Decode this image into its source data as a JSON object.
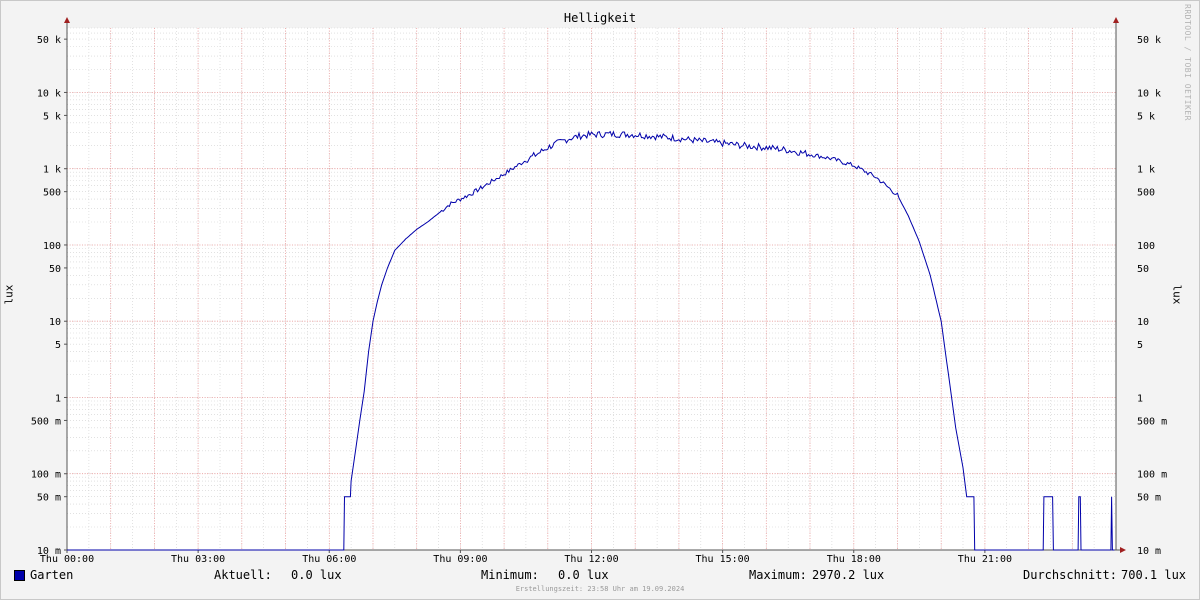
{
  "watermark": "RRDTOOL / TOBI OETIKER",
  "legend": {
    "series_name": "Garten",
    "current_label": "Aktuell:",
    "current_value": "0.0 lux",
    "min_label": "Minimum:",
    "min_value": "0.0 lux",
    "max_label": "Maximum:",
    "max_value": "2970.2 lux",
    "avg_label": "Durchschnitt:",
    "avg_value": "700.1 lux"
  },
  "footer": "Erstellungszeit: 23:58 Uhr am 19.09.2024",
  "colors": {
    "line": "#0000aa",
    "major_grid": "#f0a0a0",
    "minor_grid": "#d0d0d0",
    "background": "#ffffff",
    "page": "#f3f3f3"
  },
  "chart_data": {
    "type": "line",
    "title": "Helligkeit",
    "xlabel": "",
    "ylabel": "lux",
    "y_scale": "log",
    "ylim": [
      0.01,
      70000
    ],
    "xlim": [
      "Thu 00:00",
      "Thu 23:58"
    ],
    "x_ticks": [
      "Thu 00:00",
      "Thu 03:00",
      "Thu 06:00",
      "Thu 09:00",
      "Thu 12:00",
      "Thu 15:00",
      "Thu 18:00",
      "Thu 21:00"
    ],
    "y_ticks": [
      {
        "value": 0.01,
        "label": "10 m"
      },
      {
        "value": 0.05,
        "label": "50 m"
      },
      {
        "value": 0.1,
        "label": "100 m"
      },
      {
        "value": 0.5,
        "label": "500 m"
      },
      {
        "value": 1,
        "label": "1"
      },
      {
        "value": 5,
        "label": "5"
      },
      {
        "value": 10,
        "label": "10"
      },
      {
        "value": 50,
        "label": "50"
      },
      {
        "value": 100,
        "label": "100"
      },
      {
        "value": 500,
        "label": "500"
      },
      {
        "value": 1000,
        "label": "1 k"
      },
      {
        "value": 5000,
        "label": "5 k"
      },
      {
        "value": 10000,
        "label": "10 k"
      },
      {
        "value": 50000,
        "label": "50 k"
      }
    ],
    "grid": true,
    "legend_position": "bottom",
    "series": [
      {
        "name": "Garten",
        "color": "#0000aa",
        "points": [
          [
            "00:00",
            0.01
          ],
          [
            "06:20",
            0.01
          ],
          [
            "06:21",
            0.05
          ],
          [
            "06:29",
            0.05
          ],
          [
            "06:30",
            0.08
          ],
          [
            "06:36",
            0.2
          ],
          [
            "06:42",
            0.5
          ],
          [
            "06:48",
            1.2
          ],
          [
            "06:54",
            4
          ],
          [
            "07:00",
            10
          ],
          [
            "07:06",
            18
          ],
          [
            "07:12",
            30
          ],
          [
            "07:20",
            50
          ],
          [
            "07:30",
            85
          ],
          [
            "07:45",
            120
          ],
          [
            "08:00",
            160
          ],
          [
            "08:15",
            200
          ],
          [
            "08:30",
            260
          ],
          [
            "08:45",
            340
          ],
          [
            "09:00",
            400
          ],
          [
            "09:15",
            470
          ],
          [
            "09:30",
            570
          ],
          [
            "09:45",
            700
          ],
          [
            "10:00",
            850
          ],
          [
            "10:15",
            1050
          ],
          [
            "10:30",
            1300
          ],
          [
            "10:45",
            1550
          ],
          [
            "11:00",
            1900
          ],
          [
            "11:15",
            2200
          ],
          [
            "11:30",
            2500
          ],
          [
            "11:45",
            2700
          ],
          [
            "12:00",
            2800
          ],
          [
            "12:30",
            2850
          ],
          [
            "13:00",
            2800
          ],
          [
            "13:30",
            2650
          ],
          [
            "14:00",
            2500
          ],
          [
            "14:30",
            2300
          ],
          [
            "15:00",
            2150
          ],
          [
            "15:30",
            2000
          ],
          [
            "16:00",
            1900
          ],
          [
            "16:30",
            1750
          ],
          [
            "17:00",
            1550
          ],
          [
            "17:30",
            1350
          ],
          [
            "18:00",
            1100
          ],
          [
            "18:30",
            780
          ],
          [
            "19:00",
            450
          ],
          [
            "19:15",
            240
          ],
          [
            "19:30",
            110
          ],
          [
            "19:45",
            40
          ],
          [
            "20:00",
            10
          ],
          [
            "20:10",
            2
          ],
          [
            "20:20",
            0.4
          ],
          [
            "20:30",
            0.12
          ],
          [
            "20:35",
            0.05
          ],
          [
            "20:45",
            0.05
          ],
          [
            "20:46",
            0.01
          ],
          [
            "22:20",
            0.01
          ],
          [
            "22:21",
            0.05
          ],
          [
            "22:33",
            0.05
          ],
          [
            "22:34",
            0.01
          ],
          [
            "23:08",
            0.01
          ],
          [
            "23:09",
            0.05
          ],
          [
            "23:11",
            0.05
          ],
          [
            "23:12",
            0.01
          ],
          [
            "23:53",
            0.01
          ],
          [
            "23:54",
            0.05
          ],
          [
            "23:55",
            0.01
          ],
          [
            "23:58",
            0.01
          ]
        ]
      }
    ]
  }
}
